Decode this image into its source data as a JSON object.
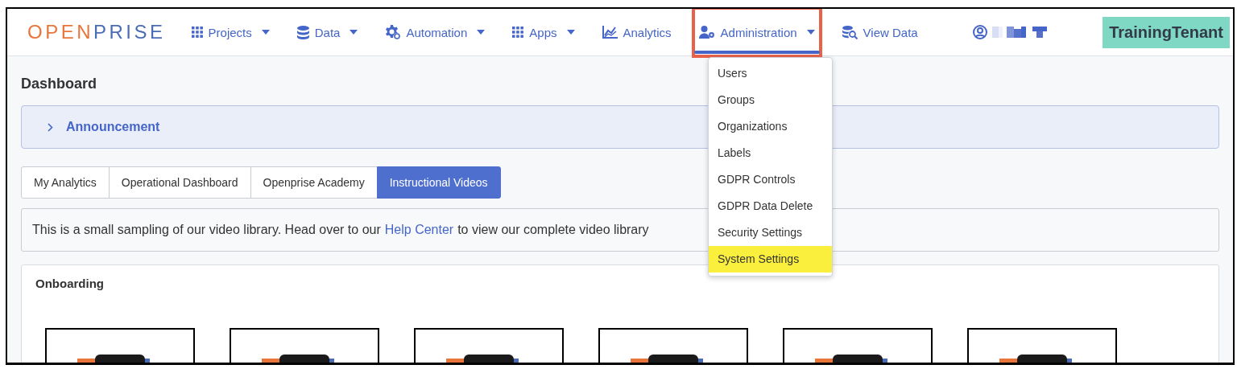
{
  "navbar": {
    "logo": {
      "part_1": "OPEN",
      "part_2": "PRISE"
    },
    "items": [
      {
        "label": "Projects",
        "kind": "grid",
        "has_caret": true,
        "selected": false,
        "annotated": false
      },
      {
        "label": "Data",
        "kind": "database",
        "has_caret": true,
        "selected": false,
        "annotated": false
      },
      {
        "label": "Automation",
        "kind": "gear",
        "has_caret": true,
        "selected": false,
        "annotated": false
      },
      {
        "label": "Apps",
        "kind": "grid",
        "has_caret": true,
        "selected": false,
        "annotated": false
      },
      {
        "label": "Analytics",
        "kind": "chart",
        "has_caret": false,
        "selected": false,
        "annotated": false
      },
      {
        "label": "Administration",
        "kind": "user-gear",
        "has_caret": true,
        "selected": true,
        "annotated": true
      },
      {
        "label": "View Data",
        "kind": "db-search",
        "has_caret": false,
        "selected": false,
        "annotated": false
      }
    ],
    "tenant": "TrainingTenant"
  },
  "dropdown": {
    "items": [
      {
        "label": "Users",
        "highlighted": false
      },
      {
        "label": "Groups",
        "highlighted": false
      },
      {
        "label": "Organizations",
        "highlighted": false
      },
      {
        "label": "Labels",
        "highlighted": false
      },
      {
        "label": "GDPR Controls",
        "highlighted": false
      },
      {
        "label": "GDPR Data Delete",
        "highlighted": false
      },
      {
        "label": "Security Settings",
        "highlighted": false
      },
      {
        "label": "System Settings",
        "highlighted": true
      }
    ]
  },
  "page_title": "Dashboard",
  "announcement": {
    "label": "Announcement",
    "expanded": false
  },
  "tabs": [
    {
      "label": "My Analytics",
      "selected": false
    },
    {
      "label": "Operational Dashboard",
      "selected": false
    },
    {
      "label": "Openprise Academy",
      "selected": false
    },
    {
      "label": "Instructional Videos",
      "selected": true
    }
  ],
  "info": {
    "text_before": "This is a small sampling of our video library. Head over to our",
    "link": "Help Center",
    "text_after": "to view our complete video library"
  },
  "section": {
    "title": "Onboarding"
  }
}
